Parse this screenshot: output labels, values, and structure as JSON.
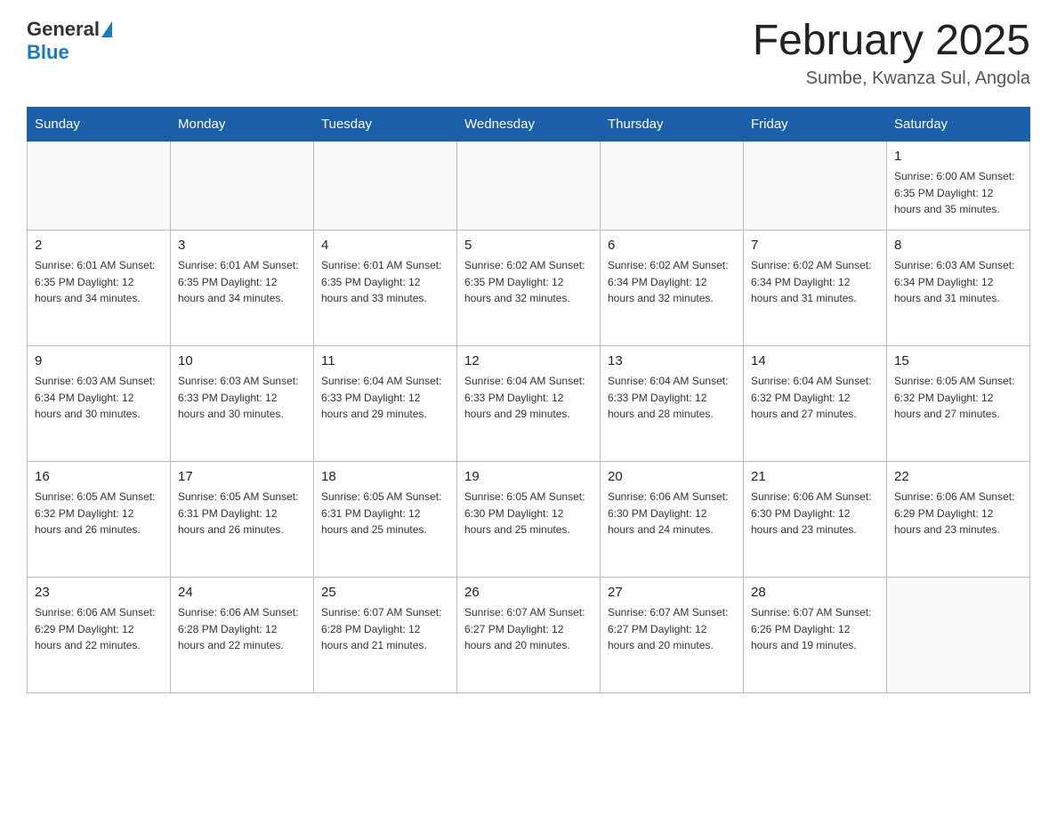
{
  "header": {
    "logo_general": "General",
    "logo_blue": "Blue",
    "month_title": "February 2025",
    "location": "Sumbe, Kwanza Sul, Angola"
  },
  "days_of_week": [
    "Sunday",
    "Monday",
    "Tuesday",
    "Wednesday",
    "Thursday",
    "Friday",
    "Saturday"
  ],
  "weeks": [
    [
      {
        "day": "",
        "info": ""
      },
      {
        "day": "",
        "info": ""
      },
      {
        "day": "",
        "info": ""
      },
      {
        "day": "",
        "info": ""
      },
      {
        "day": "",
        "info": ""
      },
      {
        "day": "",
        "info": ""
      },
      {
        "day": "1",
        "info": "Sunrise: 6:00 AM\nSunset: 6:35 PM\nDaylight: 12 hours\nand 35 minutes."
      }
    ],
    [
      {
        "day": "2",
        "info": "Sunrise: 6:01 AM\nSunset: 6:35 PM\nDaylight: 12 hours\nand 34 minutes."
      },
      {
        "day": "3",
        "info": "Sunrise: 6:01 AM\nSunset: 6:35 PM\nDaylight: 12 hours\nand 34 minutes."
      },
      {
        "day": "4",
        "info": "Sunrise: 6:01 AM\nSunset: 6:35 PM\nDaylight: 12 hours\nand 33 minutes."
      },
      {
        "day": "5",
        "info": "Sunrise: 6:02 AM\nSunset: 6:35 PM\nDaylight: 12 hours\nand 32 minutes."
      },
      {
        "day": "6",
        "info": "Sunrise: 6:02 AM\nSunset: 6:34 PM\nDaylight: 12 hours\nand 32 minutes."
      },
      {
        "day": "7",
        "info": "Sunrise: 6:02 AM\nSunset: 6:34 PM\nDaylight: 12 hours\nand 31 minutes."
      },
      {
        "day": "8",
        "info": "Sunrise: 6:03 AM\nSunset: 6:34 PM\nDaylight: 12 hours\nand 31 minutes."
      }
    ],
    [
      {
        "day": "9",
        "info": "Sunrise: 6:03 AM\nSunset: 6:34 PM\nDaylight: 12 hours\nand 30 minutes."
      },
      {
        "day": "10",
        "info": "Sunrise: 6:03 AM\nSunset: 6:33 PM\nDaylight: 12 hours\nand 30 minutes."
      },
      {
        "day": "11",
        "info": "Sunrise: 6:04 AM\nSunset: 6:33 PM\nDaylight: 12 hours\nand 29 minutes."
      },
      {
        "day": "12",
        "info": "Sunrise: 6:04 AM\nSunset: 6:33 PM\nDaylight: 12 hours\nand 29 minutes."
      },
      {
        "day": "13",
        "info": "Sunrise: 6:04 AM\nSunset: 6:33 PM\nDaylight: 12 hours\nand 28 minutes."
      },
      {
        "day": "14",
        "info": "Sunrise: 6:04 AM\nSunset: 6:32 PM\nDaylight: 12 hours\nand 27 minutes."
      },
      {
        "day": "15",
        "info": "Sunrise: 6:05 AM\nSunset: 6:32 PM\nDaylight: 12 hours\nand 27 minutes."
      }
    ],
    [
      {
        "day": "16",
        "info": "Sunrise: 6:05 AM\nSunset: 6:32 PM\nDaylight: 12 hours\nand 26 minutes."
      },
      {
        "day": "17",
        "info": "Sunrise: 6:05 AM\nSunset: 6:31 PM\nDaylight: 12 hours\nand 26 minutes."
      },
      {
        "day": "18",
        "info": "Sunrise: 6:05 AM\nSunset: 6:31 PM\nDaylight: 12 hours\nand 25 minutes."
      },
      {
        "day": "19",
        "info": "Sunrise: 6:05 AM\nSunset: 6:30 PM\nDaylight: 12 hours\nand 25 minutes."
      },
      {
        "day": "20",
        "info": "Sunrise: 6:06 AM\nSunset: 6:30 PM\nDaylight: 12 hours\nand 24 minutes."
      },
      {
        "day": "21",
        "info": "Sunrise: 6:06 AM\nSunset: 6:30 PM\nDaylight: 12 hours\nand 23 minutes."
      },
      {
        "day": "22",
        "info": "Sunrise: 6:06 AM\nSunset: 6:29 PM\nDaylight: 12 hours\nand 23 minutes."
      }
    ],
    [
      {
        "day": "23",
        "info": "Sunrise: 6:06 AM\nSunset: 6:29 PM\nDaylight: 12 hours\nand 22 minutes."
      },
      {
        "day": "24",
        "info": "Sunrise: 6:06 AM\nSunset: 6:28 PM\nDaylight: 12 hours\nand 22 minutes."
      },
      {
        "day": "25",
        "info": "Sunrise: 6:07 AM\nSunset: 6:28 PM\nDaylight: 12 hours\nand 21 minutes."
      },
      {
        "day": "26",
        "info": "Sunrise: 6:07 AM\nSunset: 6:27 PM\nDaylight: 12 hours\nand 20 minutes."
      },
      {
        "day": "27",
        "info": "Sunrise: 6:07 AM\nSunset: 6:27 PM\nDaylight: 12 hours\nand 20 minutes."
      },
      {
        "day": "28",
        "info": "Sunrise: 6:07 AM\nSunset: 6:26 PM\nDaylight: 12 hours\nand 19 minutes."
      },
      {
        "day": "",
        "info": ""
      }
    ]
  ]
}
